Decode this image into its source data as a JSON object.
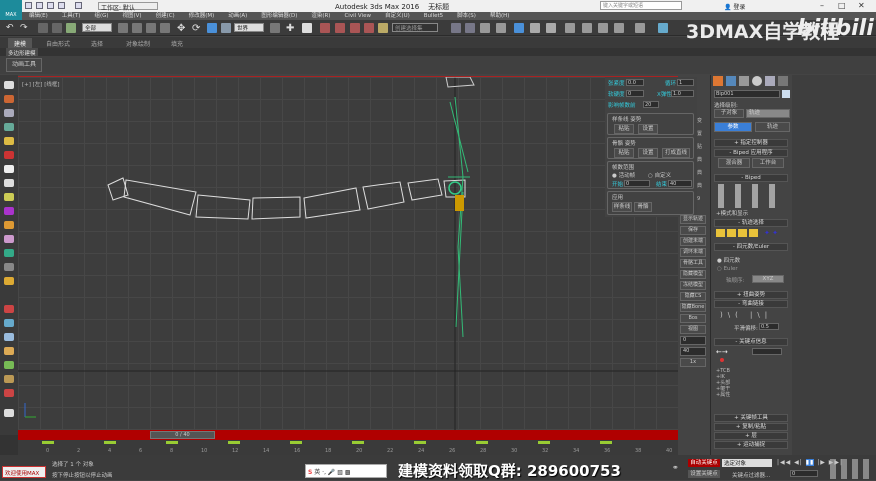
{
  "titlebar": {
    "workspace": "工作区: 默认",
    "app_title": "Autodesk 3ds Max 2016",
    "doc_title": "无标题",
    "search_placeholder": "键入关键字或短语",
    "login": "登录",
    "logo": "MAX"
  },
  "menus": [
    "编辑(E)",
    "工具(T)",
    "组(G)",
    "视图(V)",
    "创建(C)",
    "修改器(M)",
    "动画(A)",
    "图形编辑器(D)",
    "渲染(R)",
    "Civil View",
    "自定义(U)",
    "Bullet5",
    "脚本(S)",
    "帮助(H)"
  ],
  "toolbar": {
    "filter": "全部",
    "coord": "世界",
    "named_selection": "创建选择集"
  },
  "ribbon": {
    "tabs": [
      "建模",
      "自由形式",
      "选择",
      "对象绘制",
      "填充"
    ],
    "sub": "多边形建模",
    "anim_tools": "动画工具"
  },
  "viewport": {
    "label": "[+] [左] [线框]"
  },
  "motion_panel": {
    "tension_label": "张紧度",
    "tension": "0.0",
    "loop_label": "循环",
    "loop": "1",
    "bias_label": "软硬度",
    "bias": "0",
    "bounce_label": "X弹性",
    "bounce": "1.0",
    "frames_label": "影响帧数前",
    "frames": "20",
    "spline_group": "样条线 姿势",
    "paste": "粘贴",
    "set": "设置",
    "bone_group": "骨骼 姿势",
    "paste2": "粘贴",
    "set2": "设置",
    "make_straight": "打成直线",
    "range_group": "帧数范围",
    "active": "活动帧",
    "custom": "自定义",
    "start_label": "开始",
    "start": "0",
    "end_label": "结束",
    "end": "40",
    "apply_group": "应用",
    "apply_spline": "样条线",
    "apply_bone": "骨骼",
    "side_tabs": [
      "变",
      "置",
      "贴",
      "典",
      "典",
      "典",
      "9"
    ]
  },
  "side_buttons": [
    "显示轨迹",
    "保存",
    "创建未端",
    "调环未端",
    "骨骼工具",
    "隐藏模型",
    "冻结模型",
    "隐藏CS",
    "隐藏Bone",
    "Bos",
    "视图"
  ],
  "side_inputs": {
    "a": "0",
    "b": "40",
    "speed": "1x"
  },
  "command_panel": {
    "object_name": "Bip001",
    "sel_level": "选择级别:",
    "subobject": "子对象",
    "track": "轨迹",
    "params": "参数",
    "trajectories": "轨迹",
    "rollouts": [
      "指定控制器",
      "Biped 应用程序",
      "Biped",
      "轨迹选择",
      "四元数/Euler",
      "扭曲姿势",
      "弯曲链接",
      "关键点信息",
      "关键帧工具",
      "复制/粘贴",
      "层",
      "运动捕捉"
    ],
    "mixer": "混合器",
    "workbench": "工作台",
    "mode_display": "+模式和显示",
    "quat": "四元数",
    "euler": "Euler",
    "axis_order_label": "轴顺序:",
    "axis_order": "XYZ",
    "smooth_bias_label": "平滑偏移:",
    "smooth_bias": "0.5",
    "key_info": [
      "+TCB",
      "+IK",
      "+头部",
      "+躯干",
      "+属性"
    ]
  },
  "timeline": {
    "slider": "0 / 40",
    "ticks": [
      "0",
      "2",
      "4",
      "6",
      "8",
      "10",
      "12",
      "14",
      "16",
      "18",
      "20",
      "22",
      "24",
      "26",
      "28",
      "30",
      "32",
      "34",
      "36",
      "38",
      "40"
    ]
  },
  "status": {
    "selected": "选择了 1 个 对象",
    "hint": "按下停止按钮以停止动画",
    "script_btn": "欢迎使用MAX",
    "auto_key": "自动关键点",
    "set_key": "设置关键点",
    "selection_set": "选定对象",
    "key_filters": "关键点过滤器...",
    "frame": "0",
    "ime": "英"
  },
  "overlay": {
    "watermark": "3DMAX自学教程",
    "bili": "bilibili",
    "qq": "建模资料领取Q群: 289600753"
  }
}
